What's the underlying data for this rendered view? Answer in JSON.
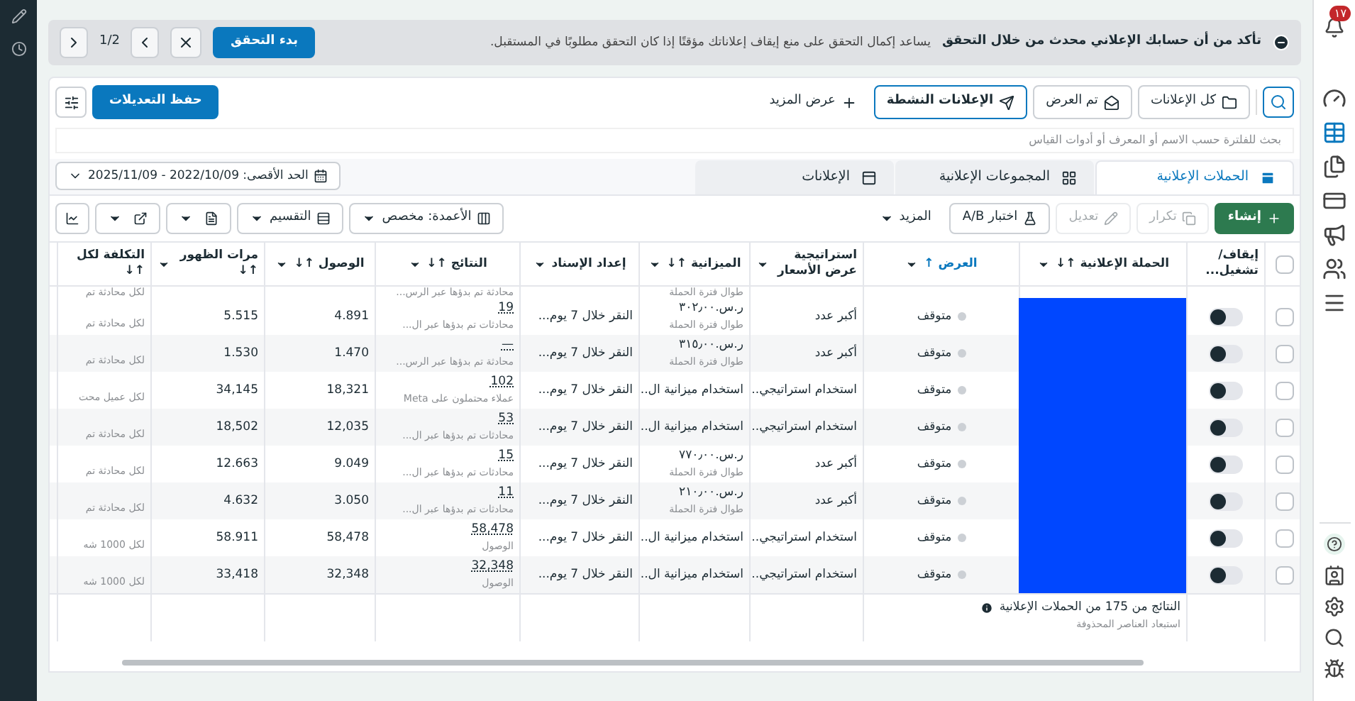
{
  "banner": {
    "title": "تأكد من أن حسابك الإعلاني محدث من خلال التحقق",
    "text": "يساعد إكمال التحقق على منع إيقاف إعلاناتك مؤقتًا إذا كان التحقق مطلوبًا في المستقبل.",
    "button": "بدء التحقق",
    "pager": "1/2"
  },
  "views": [
    {
      "label": "كل الإعلانات",
      "selected": false
    },
    {
      "label": "تم العرض",
      "selected": false
    },
    {
      "label": "الإعلانات النشطة",
      "selected": true
    }
  ],
  "more_views": "عرض المزيد",
  "save_button": "حفظ التعديلات",
  "search": {
    "placeholder": "بحث للفلترة حسب الاسم أو المعرف أو أدوات القياس"
  },
  "tabs": [
    {
      "label": "الحملات الإعلانية",
      "selected": true
    },
    {
      "label": "المجموعات الإعلانية",
      "selected": false
    },
    {
      "label": "الإعلانات",
      "selected": false
    }
  ],
  "date_range": "الحد الأقصى: 2022/10/09 - 2025/11/09",
  "actions": [
    {
      "label": "إنشاء",
      "kind": "primary",
      "disabled": false
    },
    {
      "label": "تكرار",
      "kind": "plain",
      "disabled": true
    },
    {
      "label": "تعديل",
      "kind": "plain",
      "disabled": true
    },
    {
      "label": "اختبار A/B",
      "kind": "plain",
      "disabled": false
    },
    {
      "label": "المزيد",
      "kind": "menu",
      "disabled": false
    }
  ],
  "view_controls": [
    {
      "label": "الأعمدة: مخصص"
    },
    {
      "label": "التقسيم"
    }
  ],
  "table": {
    "all_selected": false,
    "columns": [
      {
        "label": "إيقاف/تشغيل...",
        "sorted": false
      },
      {
        "label": "الحملة الإعلانية ↑↓",
        "sorted": false
      },
      {
        "label": "العرض ↑",
        "sorted": true
      },
      {
        "label": "استراتيجية عرض الأسعار",
        "sorted": false
      },
      {
        "label": "الميزانية ↑↓",
        "sorted": false
      },
      {
        "label": "إعداد الإسناد",
        "sorted": false
      },
      {
        "label": "النتائج ↑↓",
        "sorted": false
      },
      {
        "label": "الوصول ↑↓",
        "sorted": false
      },
      {
        "label": "مرات الظهور ↑↓",
        "sorted": false
      },
      {
        "label": "التكلفة لكل ↑↓",
        "sorted": false
      }
    ],
    "names_redacted": true,
    "partial_row": {
      "budget_sub": "طوال فترة الحملة",
      "result_sub": "محادثة تم بدؤها عبر الرس...",
      "cost_sub": "لكل محادثة تم"
    },
    "rows": [
      {
        "checked": false,
        "on": false,
        "status": "متوقف",
        "bid": "أكبر عدد",
        "budget": "ر.س.٣٠٢٫٠٠",
        "budget_sub": "طوال فترة الحملة",
        "attribution": "النقر خلال 7 يوم...",
        "result": "19",
        "result_sub": "محادثات تم بدؤها عبر ال...",
        "reach": "4.891",
        "impressions": "5.515",
        "cost_sub": "لكل محادثة تم"
      },
      {
        "checked": false,
        "on": false,
        "status": "متوقف",
        "bid": "أكبر عدد",
        "budget": "ر.س.٣١٥٫٠٠",
        "budget_sub": "طوال فترة الحملة",
        "attribution": "النقر خلال 7 يوم...",
        "result": "—",
        "result_sub": "محادثة تم بدؤها عبر الرس...",
        "reach": "1.470",
        "impressions": "1.530",
        "cost_sub": "لكل محادثة تم"
      },
      {
        "checked": false,
        "on": false,
        "status": "متوقف",
        "bid": "استخدام استراتيجي...",
        "budget": "استخدام ميزانية ال...",
        "attribution": "النقر خلال 7 يوم...",
        "result": "102",
        "result_sub": "عملاء محتملون على Meta",
        "reach": "18,321",
        "impressions": "34,145",
        "cost_sub": "لكل عميل محت"
      },
      {
        "checked": false,
        "on": false,
        "status": "متوقف",
        "bid": "استخدام استراتيجي...",
        "budget": "استخدام ميزانية ال...",
        "attribution": "النقر خلال 7 يوم...",
        "result": "53",
        "result_sub": "محادثات تم بدؤها عبر ال...",
        "reach": "12,035",
        "impressions": "18,502",
        "cost_sub": "لكل محادثة تم"
      },
      {
        "checked": false,
        "on": false,
        "status": "متوقف",
        "bid": "أكبر عدد",
        "budget": "ر.س.٧٧٠٫٠٠",
        "budget_sub": "طوال فترة الحملة",
        "attribution": "النقر خلال 7 يوم...",
        "result": "15",
        "result_sub": "محادثات تم بدؤها عبر ال...",
        "reach": "9.049",
        "impressions": "12.663",
        "cost_sub": "لكل محادثة تم"
      },
      {
        "checked": false,
        "on": false,
        "status": "متوقف",
        "bid": "أكبر عدد",
        "budget": "ر.س.٢١٠٫٠٠",
        "budget_sub": "طوال فترة الحملة",
        "attribution": "النقر خلال 7 يوم...",
        "result": "11",
        "result_sub": "محادثات تم بدؤها عبر ال...",
        "reach": "3.050",
        "impressions": "4.632",
        "cost_sub": "لكل محادثة تم"
      },
      {
        "checked": false,
        "on": false,
        "status": "متوقف",
        "bid": "استخدام استراتيجي...",
        "budget": "استخدام ميزانية ال...",
        "attribution": "النقر خلال 7 يوم...",
        "result": "58,478",
        "result_sub": "الوصول",
        "reach": "58,478",
        "impressions": "58.911",
        "cost_sub": "لكل 1000 شه"
      },
      {
        "checked": false,
        "on": false,
        "status": "متوقف",
        "bid": "استخدام استراتيجي...",
        "budget": "استخدام ميزانية ال...",
        "attribution": "النقر خلال 7 يوم...",
        "result": "32,348",
        "result_sub": "الوصول",
        "reach": "32,348",
        "impressions": "33,418",
        "cost_sub": "لكل 1000 شه"
      }
    ],
    "footer": {
      "text": "النتائج من 175 من الحملات الإعلانية",
      "sub": "استبعاد العناصر المحذوفة"
    }
  },
  "rail": {
    "badge": "١٧",
    "items": [
      {
        "selected": false
      },
      {
        "selected": true
      },
      {
        "selected": false
      },
      {
        "selected": false
      },
      {
        "selected": false
      },
      {
        "selected": false
      },
      {
        "selected": false
      }
    ],
    "bottom": [
      {
        "selected": false
      },
      {
        "selected": false
      },
      {
        "selected": false
      },
      {
        "selected": false
      },
      {
        "selected": false
      }
    ]
  }
}
